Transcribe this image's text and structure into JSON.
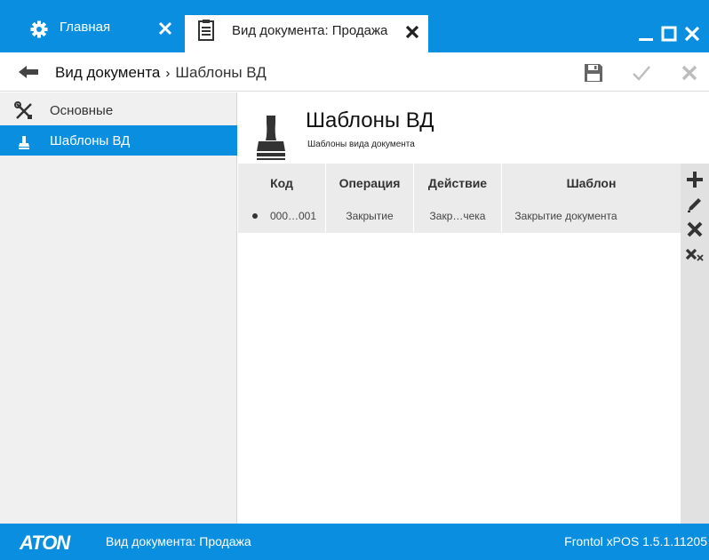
{
  "colors": {
    "accent": "#0a8fe0",
    "sidebar_bg": "#f0f0f0",
    "grid_head_bg": "#ebebeb",
    "tools_bg": "#e1e1e1"
  },
  "tabs": [
    {
      "label": "Главная",
      "icon": "gear-icon"
    },
    {
      "label": "Вид документа: Продажа",
      "icon": "document-icon"
    }
  ],
  "window_controls": [
    "minimize-icon",
    "maximize-icon",
    "close-icon"
  ],
  "breadcrumb": {
    "parent": "Вид документа",
    "separator": "›",
    "current": "Шаблоны ВД"
  },
  "toolbar": {
    "icons": [
      "save-icon",
      "check-icon",
      "close-icon"
    ]
  },
  "sidebar": {
    "items": [
      {
        "label": "Основные",
        "icon": "tools-icon"
      },
      {
        "label": "Шаблоны ВД",
        "icon": "stamp-icon"
      }
    ]
  },
  "main": {
    "title": "Шаблоны ВД",
    "subtitle": "Шаблоны вида документа",
    "columns": [
      "Код",
      "Операция",
      "Действие",
      "Шаблон"
    ],
    "rows": [
      {
        "code": "000…001",
        "operation": "Закрытие",
        "action": "Закр…чека",
        "template": "Закрытие документа"
      }
    ]
  },
  "right_tools": [
    "add-icon",
    "edit-icon",
    "delete-icon",
    "delete-all-icon"
  ],
  "status": {
    "logo": "ATON",
    "left": "Вид документа: Продажа",
    "right": "Frontol xPOS 1.5.1.11205"
  }
}
